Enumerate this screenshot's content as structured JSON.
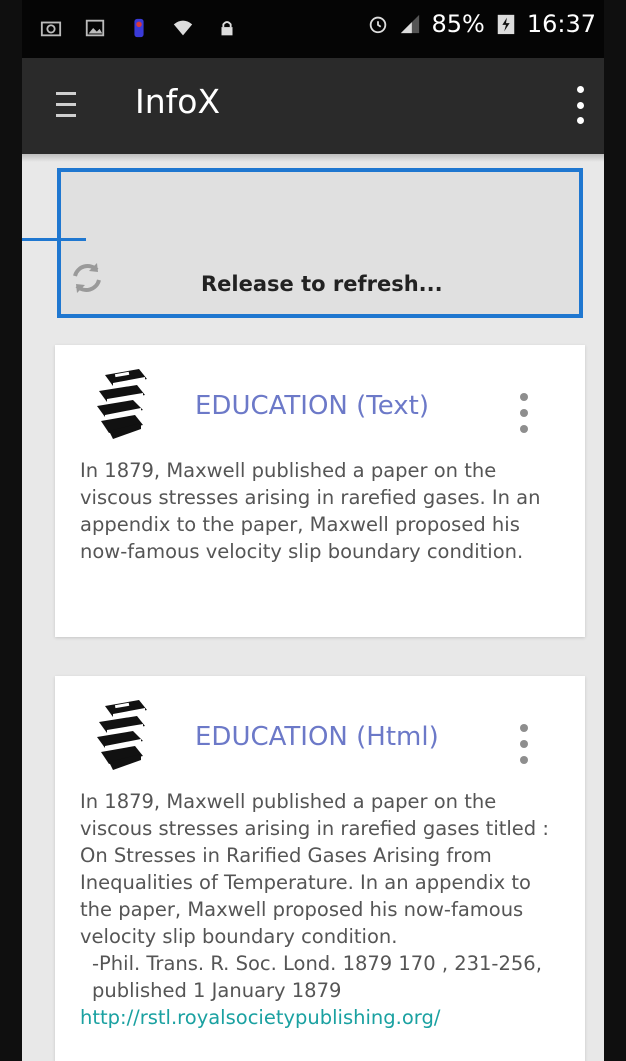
{
  "status_bar": {
    "battery": "85%",
    "time": "16:37"
  },
  "app_bar": {
    "title": "InfoX"
  },
  "refresh": {
    "label": "Release to refresh..."
  },
  "cards": [
    {
      "title": "EDUCATION (Text)",
      "body": "In 1879, Maxwell published a paper on the viscous stresses arising in rarefied gases. In an appendix to the paper, Maxwell proposed his now-famous velocity slip boundary condition."
    },
    {
      "title": "EDUCATION (Html)",
      "body": "In 1879, Maxwell published a paper on the viscous stresses arising in rarefied gases titled : On Stresses in Rarified Gases Arising from Inequalities of Temperature. In an appendix to the paper, Maxwell proposed his now-famous velocity slip boundary condition.",
      "reference": "-Phil. Trans. R. Soc. Lond. 1879 170 , 231-256, published 1 January 1879",
      "link": "http://rstl.royalsocietypublishing.org/"
    }
  ],
  "colors": {
    "accent": "#6c79c8",
    "highlight": "#1f77d0",
    "link": "#1aa1a1"
  }
}
